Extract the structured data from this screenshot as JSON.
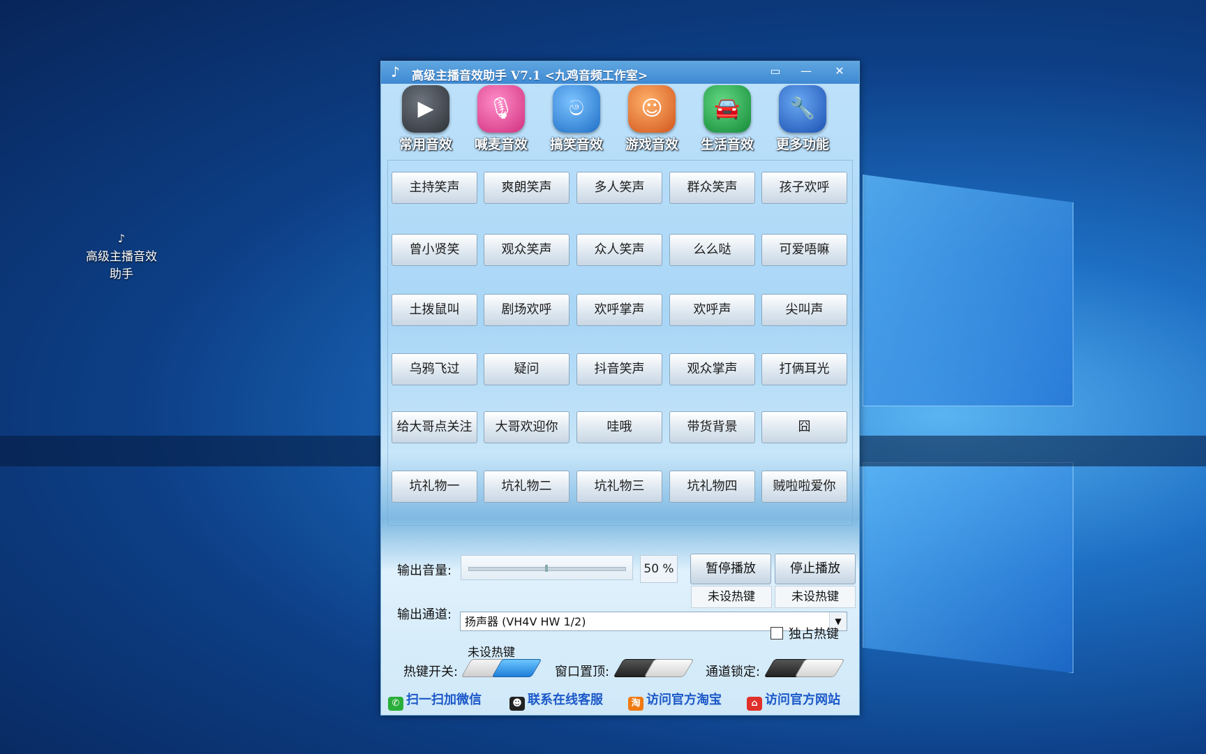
{
  "desktop": {
    "icon_label_line1": "高级主播音效",
    "icon_label_line2": "助手"
  },
  "window": {
    "title": "高级主播音效助手 V7.1 <九鸡音频工作室>",
    "controls": {
      "restore": "▭",
      "minimize": "—",
      "close": "✕"
    }
  },
  "nav": [
    {
      "label": "常用音效",
      "icon": "play-icon",
      "color": "#3b4048"
    },
    {
      "label": "喊麦音效",
      "icon": "microphone-icon",
      "color": "#e0449a"
    },
    {
      "label": "搞笑音效",
      "icon": "swirl-icon",
      "color": "#2f86d8"
    },
    {
      "label": "游戏音效",
      "icon": "game-character-icon",
      "color": "#e0702a"
    },
    {
      "label": "生活音效",
      "icon": "car-icon",
      "color": "#23a246"
    },
    {
      "label": "更多功能",
      "icon": "wrench-icon",
      "color": "#2a66c4"
    }
  ],
  "sound_buttons": [
    [
      "主持笑声",
      "爽朗笑声",
      "多人笑声",
      "群众笑声",
      "孩子欢呼"
    ],
    [
      "曾小贤笑",
      "观众笑声",
      "众人笑声",
      "么么哒",
      "可爱唔嘛"
    ],
    [
      "土拨鼠叫",
      "剧场欢呼",
      "欢呼掌声",
      "欢呼声",
      "尖叫声"
    ],
    [
      "乌鸦飞过",
      "疑问",
      "抖音笑声",
      "观众掌声",
      "打俩耳光"
    ],
    [
      "给大哥点关注",
      "大哥欢迎你",
      "哇哦",
      "带货背景",
      "囧"
    ],
    [
      "坑礼物一",
      "坑礼物二",
      "坑礼物三",
      "坑礼物四",
      "贼啦啦爱你"
    ]
  ],
  "controls": {
    "volume_label": "输出音量:",
    "volume_percent_text": "50 %",
    "volume_value": 0.5,
    "pause_label": "暂停播放",
    "stop_label": "停止播放",
    "pause_hotkey": "未设热键",
    "stop_hotkey": "未设热键",
    "channel_label": "输出通道:",
    "channel_value": "扬声器 (VH4V HW 1/2)",
    "exclusive_hotkey_label": "独占热键",
    "exclusive_hotkey_checked": false
  },
  "toggles": {
    "hotkey_status": "未设热键",
    "hotkey_switch_label": "热键开关:",
    "hotkey_switch_on": true,
    "window_top_label": "窗口置顶:",
    "window_top_on": false,
    "channel_lock_label": "通道锁定:",
    "channel_lock_on": false
  },
  "links": [
    {
      "label": "扫一扫加微信",
      "icon": "wechat-icon",
      "color": "#2aae3a"
    },
    {
      "label": "联系在线客服",
      "icon": "qq-icon",
      "color": "#222222"
    },
    {
      "label": "访问官方淘宝",
      "icon": "taobao-icon",
      "color": "#f07a12"
    },
    {
      "label": "访问官方网站",
      "icon": "home-icon",
      "color": "#e0302a"
    }
  ]
}
